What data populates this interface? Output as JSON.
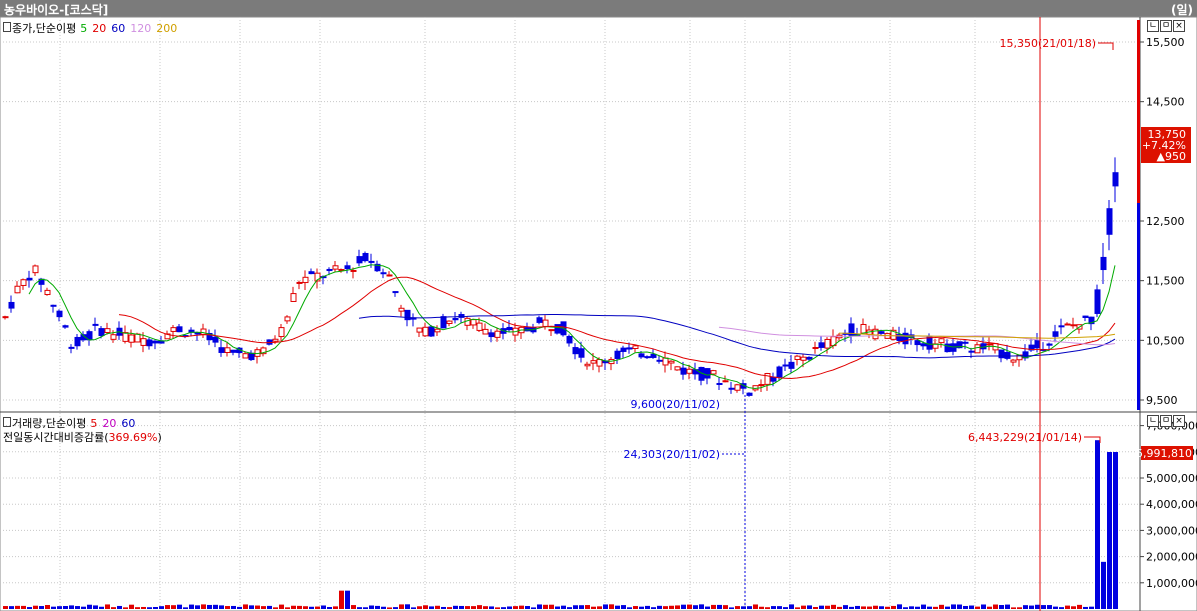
{
  "window": {
    "title": "농우바이오-[코스닥]",
    "period": "(일)"
  },
  "price_panel": {
    "legend_prefix": "종가,단순이평",
    "ma": [
      {
        "label": "5",
        "color": "#00aa00"
      },
      {
        "label": "20",
        "color": "#e00000"
      },
      {
        "label": "60",
        "color": "#0000c0"
      },
      {
        "label": "120",
        "color": "#d090e0"
      },
      {
        "label": "200",
        "color": "#d0a000"
      }
    ],
    "y_ticks": [
      "15,500",
      "14,500",
      "13,750",
      "12,500",
      "11,500",
      "10,500",
      "9,500"
    ],
    "max_annotation": "15,350(21/01/18)",
    "min_annotation": "9,600(20/11/02)",
    "current": {
      "price": "13,750",
      "change_pct": "+7.42%",
      "change": "▲950"
    }
  },
  "volume_panel": {
    "legend_prefix": "거래량,단순이평",
    "ma": [
      {
        "label": "5",
        "color": "#e00000"
      },
      {
        "label": "20",
        "color": "#c000c0"
      },
      {
        "label": "60",
        "color": "#0000c0"
      }
    ],
    "sub_label": "전일동시간대비증감률(",
    "sub_value": "369.69%",
    "sub_close": ")",
    "y_ticks": [
      "7,000,000",
      "6,000,000",
      "5,000,000",
      "4,000,000",
      "3,000,000",
      "2,000,000",
      "1,000,000"
    ],
    "max_annotation": "6,443,229(21/01/14)",
    "min_annotation": "24,303(20/11/02)",
    "current_volume": "5,991,810"
  },
  "colors": {
    "up": "#e00000",
    "down": "#0000e0",
    "grid": "#c8c8c8"
  },
  "window_buttons": [
    "ㄴ",
    "ㅁ",
    "×"
  ]
}
